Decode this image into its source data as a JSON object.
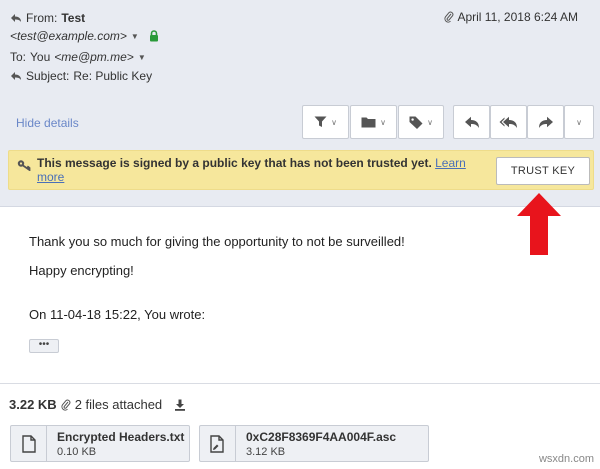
{
  "header": {
    "from_label": "From:",
    "from_name": "Test",
    "from_email": "<test@example.com>",
    "to_label": "To:",
    "to_name": "You",
    "to_email": "<me@pm.me>",
    "subject_label": "Subject:",
    "subject": "Re: Public Key",
    "date": "April 11, 2018 6:24 AM",
    "hide_details": "Hide details"
  },
  "alert": {
    "message": "This message is signed by a public key that has not been trusted yet.",
    "learn_more": "Learn more",
    "trust_button": "TRUST KEY",
    "arrow_color": "#e8141c"
  },
  "message": {
    "line1": "Thank you so much for giving the opportunity to not be surveilled!",
    "line2": "Happy encrypting!",
    "line3": "On 11-04-18 15:22, You wrote:",
    "ellipsis": "•••"
  },
  "attachments": {
    "total_size": "3.22 KB",
    "count_text": "2 files attached",
    "files": [
      {
        "name": "Encrypted Headers.txt",
        "size": "0.10 KB"
      },
      {
        "name": "0xC28F8369F4AA004F.asc",
        "size": "3.12 KB"
      }
    ]
  },
  "watermark": "wsxdn.com"
}
